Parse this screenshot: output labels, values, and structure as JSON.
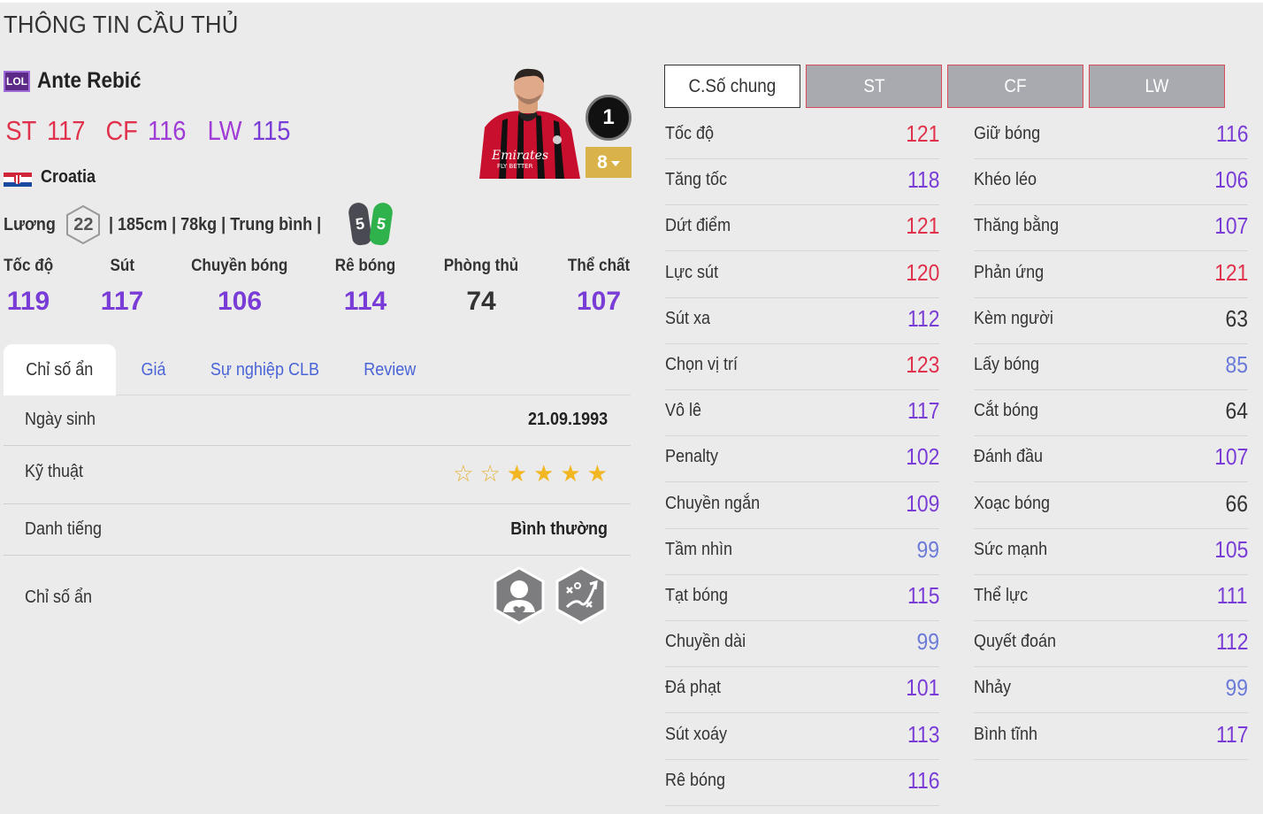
{
  "page_title": "THÔNG TIN CẦU THỦ",
  "player": {
    "season_badge": "LOL",
    "name": "Ante Rebić",
    "positions": [
      {
        "pos": "ST",
        "ovr": "117"
      },
      {
        "pos": "CF",
        "ovr": "116"
      },
      {
        "pos": "LW",
        "ovr": "115"
      }
    ],
    "nation": "Croatia",
    "rank_badge": "1",
    "upgrade_level": "8"
  },
  "salary": {
    "label": "Lương",
    "value": "22",
    "details": "| 185cm | 78kg | Trung bình |",
    "left_foot": "5",
    "right_foot": "5"
  },
  "summary_stats": [
    {
      "label": "Tốc độ",
      "value": "119"
    },
    {
      "label": "Sút",
      "value": "117"
    },
    {
      "label": "Chuyền bóng",
      "value": "106"
    },
    {
      "label": "Rê bóng",
      "value": "114"
    },
    {
      "label": "Phòng thủ",
      "value": "74"
    },
    {
      "label": "Thể chất",
      "value": "107"
    }
  ],
  "tabs": [
    "Chỉ số ẩn",
    "Giá",
    "Sự nghiệp CLB",
    "Review"
  ],
  "info": {
    "birth_label": "Ngày sinh",
    "birth_value": "21.09.1993",
    "skill_label": "Kỹ thuật",
    "skill_stars": 4,
    "skill_max": 6,
    "fame_label": "Danh tiếng",
    "fame_value": "Bình thường",
    "hidden_label": "Chỉ số ẩn",
    "traits": [
      "fan-favourite-icon",
      "playmaker-dribble-icon"
    ]
  },
  "position_tabs": [
    "C.Số chung",
    "ST",
    "CF",
    "LW"
  ],
  "attributes_left": [
    {
      "name": "Tốc độ",
      "value": "121",
      "color": "red"
    },
    {
      "name": "Tăng tốc",
      "value": "118",
      "color": "purple"
    },
    {
      "name": "Dứt điểm",
      "value": "121",
      "color": "red"
    },
    {
      "name": "Lực sút",
      "value": "120",
      "color": "red"
    },
    {
      "name": "Sút xa",
      "value": "112",
      "color": "purple"
    },
    {
      "name": "Chọn vị trí",
      "value": "123",
      "color": "red"
    },
    {
      "name": "Vô lê",
      "value": "117",
      "color": "purple"
    },
    {
      "name": "Penalty",
      "value": "102",
      "color": "purple"
    },
    {
      "name": "Chuyền ngắn",
      "value": "109",
      "color": "purple"
    },
    {
      "name": "Tầm nhìn",
      "value": "99",
      "color": "blue"
    },
    {
      "name": "Tạt bóng",
      "value": "115",
      "color": "purple"
    },
    {
      "name": "Chuyền dài",
      "value": "99",
      "color": "blue"
    },
    {
      "name": "Đá phạt",
      "value": "101",
      "color": "purple"
    },
    {
      "name": "Sút xoáy",
      "value": "113",
      "color": "purple"
    },
    {
      "name": "Rê bóng",
      "value": "116",
      "color": "purple"
    }
  ],
  "attributes_right": [
    {
      "name": "Giữ bóng",
      "value": "116",
      "color": "purple"
    },
    {
      "name": "Khéo léo",
      "value": "106",
      "color": "purple"
    },
    {
      "name": "Thăng bằng",
      "value": "107",
      "color": "purple"
    },
    {
      "name": "Phản ứng",
      "value": "121",
      "color": "red"
    },
    {
      "name": "Kèm người",
      "value": "63",
      "color": "dark"
    },
    {
      "name": "Lấy bóng",
      "value": "85",
      "color": "blue"
    },
    {
      "name": "Cắt bóng",
      "value": "64",
      "color": "dark"
    },
    {
      "name": "Đánh đầu",
      "value": "107",
      "color": "purple"
    },
    {
      "name": "Xoạc bóng",
      "value": "66",
      "color": "dark"
    },
    {
      "name": "Sức mạnh",
      "value": "105",
      "color": "purple"
    },
    {
      "name": "Thể lực",
      "value": "111",
      "color": "purple"
    },
    {
      "name": "Quyết đoán",
      "value": "112",
      "color": "purple"
    },
    {
      "name": "Nhảy",
      "value": "99",
      "color": "blue"
    },
    {
      "name": "Bình tĩnh",
      "value": "117",
      "color": "purple"
    }
  ],
  "colors": {
    "red": "#e0324c",
    "purple": "#7a3cd6",
    "blue": "#6a7ad8",
    "dark": "#333333"
  }
}
